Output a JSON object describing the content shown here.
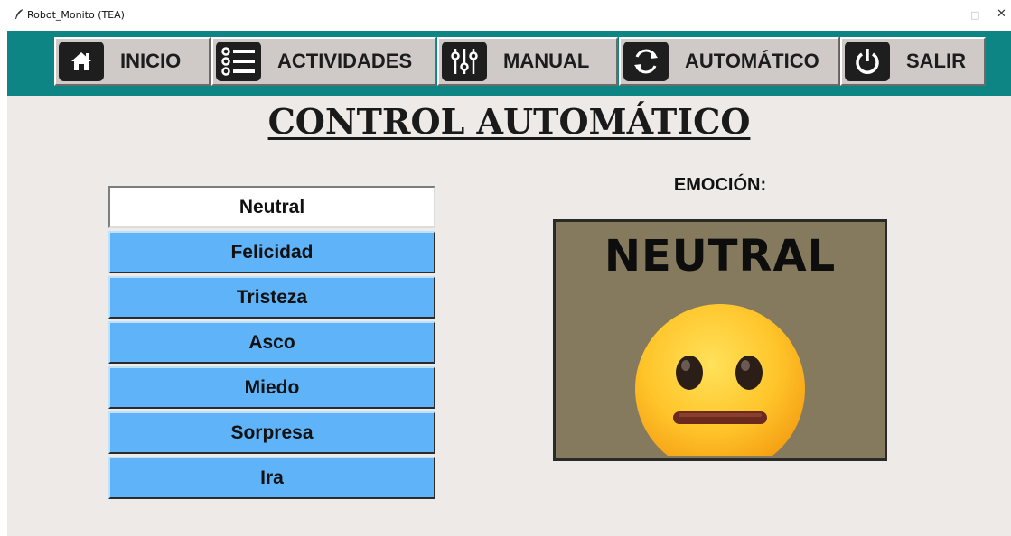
{
  "window": {
    "title": "Robot_Monito (TEA)",
    "minimize": "–",
    "maximize": "□",
    "close": "✕"
  },
  "nav": {
    "items": [
      {
        "label": "INICIO",
        "icon": "home-icon"
      },
      {
        "label": "ACTIVIDADES",
        "icon": "list-icon"
      },
      {
        "label": "MANUAL",
        "icon": "sliders-icon"
      },
      {
        "label": "AUTOMÁTICO",
        "icon": "refresh-icon"
      },
      {
        "label": "SALIR",
        "icon": "power-icon"
      }
    ]
  },
  "page": {
    "title": "CONTROL AUTOMÁTICO"
  },
  "emotions": {
    "selected": "Neutral",
    "items": [
      "Neutral",
      "Felicidad",
      "Tristeza",
      "Asco",
      "Miedo",
      "Sorpresa",
      "Ira"
    ]
  },
  "display": {
    "heading": "EMOCIÓN:",
    "text": "NEUTRAL",
    "icon": "neutral-face-icon"
  },
  "colors": {
    "navbar": "#0e8585",
    "emotion_button": "#5fb3f8",
    "panel_background": "#867a5e",
    "app_background": "#edeae8"
  }
}
